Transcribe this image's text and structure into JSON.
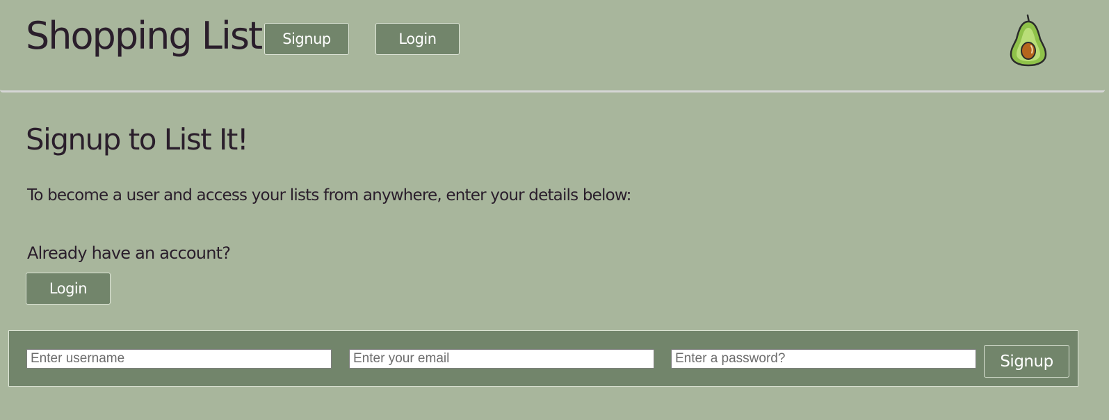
{
  "header": {
    "title": "Shopping List",
    "nav": {
      "signup_label": "Signup",
      "login_label": "Login"
    },
    "logo_icon": "avocado-icon"
  },
  "main": {
    "heading": "Signup to List It!",
    "intro": "To become a user and access your lists from anywhere, enter your details below:",
    "account_prompt": "Already have an account?",
    "login_label": "Login"
  },
  "form": {
    "username_placeholder": "Enter username",
    "email_placeholder": "Enter your email",
    "password_placeholder": "Enter a password?",
    "submit_label": "Signup"
  },
  "colors": {
    "background": "#a8b69c",
    "button": "#72856b",
    "text": "#2a1e2b",
    "avocado_skin": "#8fc24a",
    "avocado_pit": "#b5651d"
  }
}
